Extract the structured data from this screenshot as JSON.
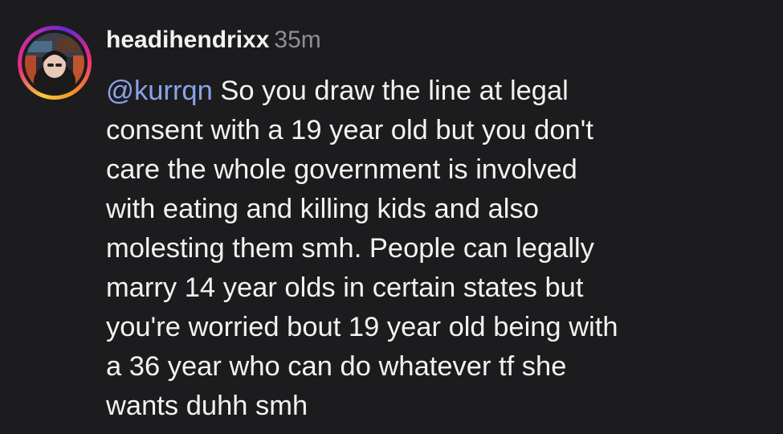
{
  "comment": {
    "username": "headihendrixx",
    "timestamp": "35m",
    "mention": "@kurrqn",
    "lines": [
      " So you draw the line at legal",
      "consent with a 19 year old but you don't",
      "care the whole government is involved",
      "with eating and killing kids and also",
      "molesting them smh. People can legally",
      "marry 14 year olds in certain states but",
      "you're worried bout 19 year old being with",
      "a 36 year who can do whatever tf she",
      "wants duhh smh"
    ]
  },
  "colors": {
    "background": "#1c1c1e",
    "text": "#f2f2f2",
    "muted": "#8e8e93",
    "mention": "#8aa2e8"
  },
  "icons": {
    "avatar": "profile-photo"
  }
}
